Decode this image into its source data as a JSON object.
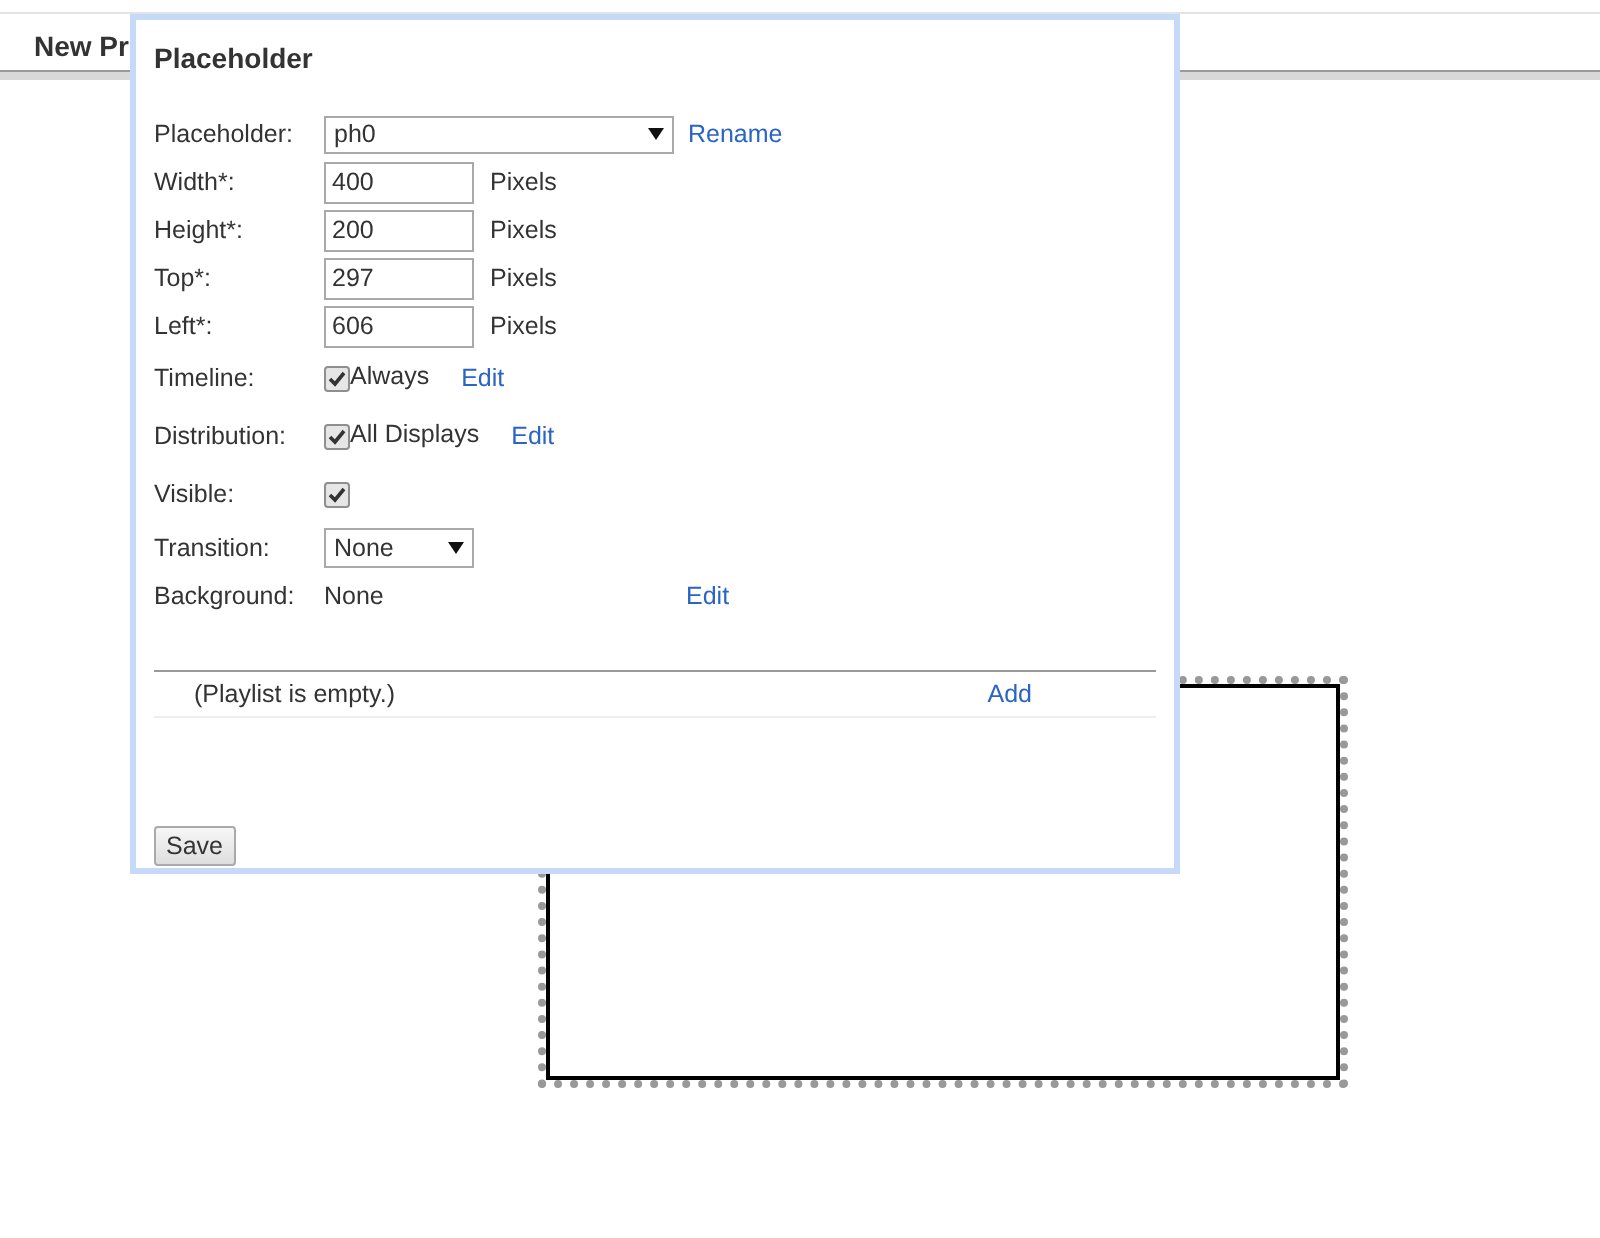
{
  "page": {
    "header": "New Pr"
  },
  "canvas": {
    "placeholders": [
      {
        "selected": true
      }
    ]
  },
  "dialog": {
    "title": "Placeholder",
    "rows": [
      {
        "kind": "select",
        "label": "Placeholder:",
        "value": "ph0",
        "link": "Rename"
      },
      {
        "kind": "number",
        "label": "Width*:",
        "value": "400",
        "unit": "Pixels"
      },
      {
        "kind": "number",
        "label": "Height*:",
        "value": "200",
        "unit": "Pixels"
      },
      {
        "kind": "number",
        "label": "Top*:",
        "value": "297",
        "unit": "Pixels"
      },
      {
        "kind": "number",
        "label": "Left*:",
        "value": "606",
        "unit": "Pixels"
      },
      {
        "kind": "checkbox",
        "label": "Timeline:",
        "checked": true,
        "text": "Always",
        "link": "Edit"
      },
      {
        "kind": "checkbox",
        "label": "Distribution:",
        "checked": true,
        "text": "All Displays",
        "link": "Edit"
      },
      {
        "kind": "checkbox",
        "label": "Visible:",
        "checked": true
      },
      {
        "kind": "smallselect",
        "label": "Transition:",
        "value": "None"
      },
      {
        "kind": "plain",
        "label": "Background:",
        "value": "None",
        "link": "Edit"
      }
    ],
    "playlist": {
      "empty_text": "(Playlist is empty.)",
      "add": "Add"
    },
    "save": "Save"
  }
}
